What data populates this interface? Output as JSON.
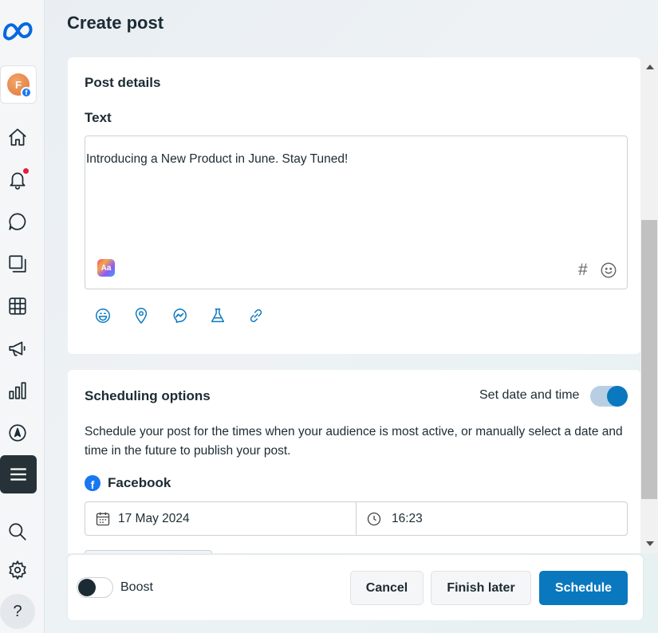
{
  "page": {
    "title": "Create post"
  },
  "sidebar": {
    "avatar_letter": "F",
    "avatar_badge": "f",
    "help_label": "?"
  },
  "post_details": {
    "section_title": "Post details",
    "text_label": "Text",
    "text_value": "Introducing a New Product in June. Stay Tuned!",
    "format_icon_label": "Aa",
    "hashtag_symbol": "#"
  },
  "scheduling": {
    "section_title": "Scheduling options",
    "toggle_label": "Set date and time",
    "toggle_on": true,
    "description": "Schedule your post for the times when your audience is most active, or manually select a date and time in the future to publish your post.",
    "platform_name": "Facebook",
    "platform_logo": "f",
    "date": "17 May 2024",
    "time": "16:23"
  },
  "footer": {
    "boost_label": "Boost",
    "boost_on": false,
    "cancel_label": "Cancel",
    "finish_later_label": "Finish later",
    "schedule_label": "Schedule"
  },
  "colors": {
    "accent": "#0a78be",
    "text": "#1c2b33",
    "facebook": "#1877f2",
    "notification": "#e41e3f"
  }
}
